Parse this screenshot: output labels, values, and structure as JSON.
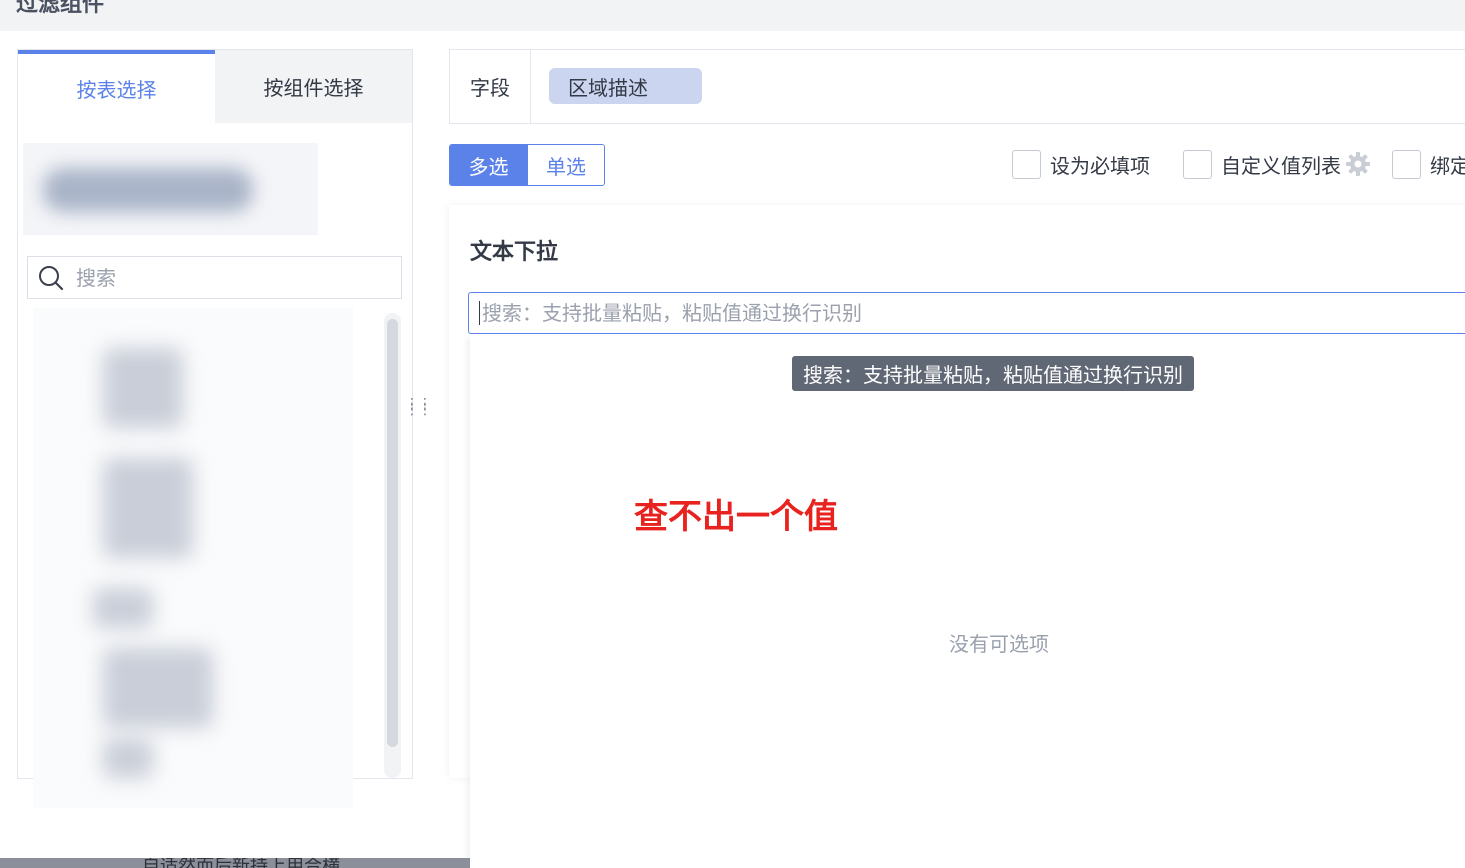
{
  "page": {
    "title": "过滤组件"
  },
  "left_panel": {
    "tabs": [
      {
        "label": "按表选择",
        "active": true
      },
      {
        "label": "按组件选择",
        "active": false
      }
    ],
    "search": {
      "placeholder": "搜索"
    }
  },
  "field": {
    "label": "字段",
    "tag": "区域描述"
  },
  "mode_toggle": {
    "options": [
      {
        "label": "多选",
        "active": true
      },
      {
        "label": "单选",
        "active": false
      }
    ]
  },
  "options": {
    "required": {
      "label": "设为必填项",
      "checked": false
    },
    "custom_values": {
      "label": "自定义值列表",
      "checked": false,
      "icon": "gear-icon"
    },
    "bind": {
      "label": "绑定",
      "checked": false
    }
  },
  "card": {
    "title": "文本下拉",
    "search_placeholder": "搜索：支持批量粘贴，粘贴值通过换行识别",
    "tooltip": "搜索：支持批量粘贴，粘贴值通过换行识别",
    "empty_text": "没有可选项"
  },
  "annotation": "查不出一个值",
  "bottom_bar": {
    "text": "自适然而后新持上用合横"
  },
  "colors": {
    "accent": "#5b82e8",
    "tag_bg": "#cbd5f0",
    "annotation": "#e8231f",
    "tooltip_bg": "#606775"
  }
}
